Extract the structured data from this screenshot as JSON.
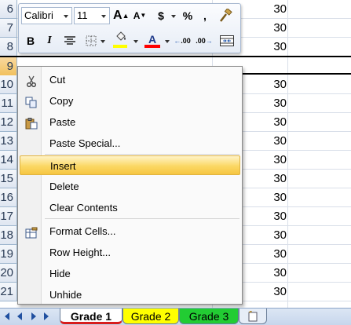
{
  "grid": {
    "rows": [
      {
        "num": "6",
        "value": "30"
      },
      {
        "num": "7",
        "value": "30"
      },
      {
        "num": "8",
        "value": "30"
      },
      {
        "num": "9",
        "value": ""
      },
      {
        "num": "10",
        "value": "30"
      },
      {
        "num": "11",
        "value": "30"
      },
      {
        "num": "12",
        "value": "30"
      },
      {
        "num": "13",
        "value": "30"
      },
      {
        "num": "14",
        "value": "30"
      },
      {
        "num": "15",
        "value": "30"
      },
      {
        "num": "16",
        "value": "30"
      },
      {
        "num": "17",
        "value": "30"
      },
      {
        "num": "18",
        "value": "30"
      },
      {
        "num": "19",
        "value": "30"
      },
      {
        "num": "20",
        "value": "30"
      },
      {
        "num": "21",
        "value": "30"
      }
    ]
  },
  "mini_toolbar": {
    "font_name": "Calibri",
    "font_size": "11",
    "grow_font": "A",
    "shrink_font": "A",
    "currency": "$",
    "percent": "%",
    "comma": ",",
    "bold": "B",
    "italic": "I",
    "font_color_letter": "A",
    "fill_color": "#ffff00",
    "font_color": "#ff0000",
    "inc_decimal": ".00",
    "dec_decimal": ".00"
  },
  "context_menu": {
    "items": [
      {
        "label": "Cut",
        "icon": "scissors-icon"
      },
      {
        "label": "Copy",
        "icon": "copy-icon"
      },
      {
        "label": "Paste",
        "icon": "paste-icon"
      },
      {
        "label": "Paste Special...",
        "icon": ""
      },
      {
        "label": "Insert",
        "icon": "",
        "highlighted": true
      },
      {
        "label": "Delete",
        "icon": ""
      },
      {
        "label": "Clear Contents",
        "icon": ""
      },
      {
        "label": "Format Cells...",
        "icon": "format-cells-icon"
      },
      {
        "label": "Row Height...",
        "icon": ""
      },
      {
        "label": "Hide",
        "icon": ""
      },
      {
        "label": "Unhide",
        "icon": ""
      }
    ]
  },
  "sheet_tabs": {
    "tabs": [
      {
        "label": "Grade 1",
        "color": "#ffffff",
        "active": true
      },
      {
        "label": "Grade 2",
        "color": "#ffff00",
        "active": false
      },
      {
        "label": "Grade 3",
        "color": "#22cc33",
        "active": false
      }
    ],
    "accent": "#d71c1c"
  }
}
